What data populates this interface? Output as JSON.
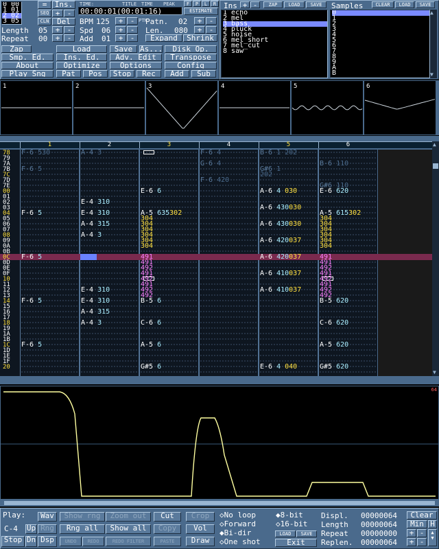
{
  "song_positions": [
    {
      "pos": "0",
      "pat": "00"
    },
    {
      "pos": "1",
      "pat": "01"
    },
    {
      "pos": "2",
      "pat": "02"
    },
    {
      "pos": "3",
      "pat": "05"
    }
  ],
  "top_left": {
    "eq": "=",
    "ins_btn": "Ins.",
    "seq": "SEQ",
    "cln": "CLN",
    "del": "Del",
    "length_label": "Length",
    "length_val": "05",
    "repeat_label": "Repeat",
    "repeat_val": "00",
    "plus": "+",
    "minus": "-"
  },
  "time": {
    "time_label": "TIME:",
    "time_value": "00:00:01(00:01:16)",
    "title_tab": "TITLE",
    "time_tab": "TIME",
    "peak_tab": "PEAK",
    "estimate": "ESTIMATE"
  },
  "tempo": {
    "bpm_label": "BPM",
    "bpm_val": "125",
    "spd_label": "Spd",
    "spd_val": "06",
    "add_label": "Add",
    "add_val": "01",
    "pattern_label": "Patn.",
    "pattern_val": "02",
    "len_label": "Len.",
    "len_val": "080",
    "expand": "Expand",
    "shrink": "Shrink",
    "ptn_tab": "PTN"
  },
  "instruments": {
    "label": "Ins",
    "zap": "ZAP",
    "load": "LOAD",
    "save": "SAVE",
    "items": [
      {
        "num": "1",
        "name": "echo"
      },
      {
        "num": "2",
        "name": "mel"
      },
      {
        "num": "3",
        "name": "bass"
      },
      {
        "num": "4",
        "name": "pluck"
      },
      {
        "num": "5",
        "name": "noise"
      },
      {
        "num": "6",
        "name": "mel_short"
      },
      {
        "num": "7",
        "name": "mel_cut"
      },
      {
        "num": "8",
        "name": "saw"
      }
    ],
    "selected": 2
  },
  "samples": {
    "label": "Samples",
    "clear": "CLEAR",
    "load": "LOAD",
    "save": "SAVE",
    "items": [
      "0",
      "1",
      "2",
      "3",
      "4",
      "5",
      "6",
      "7",
      "8",
      "9",
      "A",
      "B"
    ],
    "selected": 0
  },
  "menu": [
    [
      "Zap",
      "Load",
      "Save",
      "As...",
      "Disk Op."
    ],
    [
      "Smp. Ed.",
      "Ins. Ed.",
      "Adv. Edit",
      "Transpose"
    ],
    [
      "About",
      "Optimize",
      "Options",
      "Config"
    ],
    [
      "Play Sng",
      "Pat",
      "Pos",
      "Stop",
      "Rec",
      "Add",
      "Sub"
    ]
  ],
  "scopes": [
    "1",
    "2",
    "3",
    "4",
    "5",
    "6"
  ],
  "channels": [
    "1",
    "2",
    "3",
    "4",
    "5",
    "6"
  ],
  "rows": [
    {
      "n": "78",
      "c": [
        "F-6 530",
        "A-4 3",
        "",
        "F-6 4",
        "B-6 1   202",
        ""
      ],
      "d": 1,
      "box": [
        0,
        0,
        1,
        0,
        0,
        0
      ]
    },
    {
      "n": "79",
      "c": [
        "",
        "",
        "",
        "",
        "",
        ""
      ],
      "d": 1
    },
    {
      "n": "7A",
      "c": [
        "",
        "",
        "",
        "G-6 4",
        "",
        "B-6 110"
      ],
      "d": 1
    },
    {
      "n": "7B",
      "c": [
        "F-6 5",
        "",
        "",
        "",
        "G#6 1",
        ""
      ],
      "d": 1
    },
    {
      "n": "7C",
      "c": [
        "",
        "",
        "",
        "",
        "        202",
        ""
      ],
      "d": 1
    },
    {
      "n": "7D",
      "c": [
        "",
        "",
        "",
        "F-6 420",
        "",
        ""
      ],
      "d": 1
    },
    {
      "n": "7E",
      "c": [
        "",
        "",
        "",
        "",
        "",
        "G#6 110"
      ],
      "d": 1
    },
    {
      "n": "00",
      "c": [
        "",
        "",
        "E-6 6",
        "",
        "A-6 4   030",
        "E-6 620"
      ]
    },
    {
      "n": "01",
      "c": [
        "",
        "",
        "",
        "",
        "",
        ""
      ]
    },
    {
      "n": "02",
      "c": [
        "",
        "E-4 310",
        "",
        "",
        "",
        ""
      ]
    },
    {
      "n": "03",
      "c": [
        "",
        "",
        "",
        "",
        "A-6 430030",
        ""
      ]
    },
    {
      "n": "04",
      "c": [
        "F-6 5",
        "E-4 310",
        "A-5 635302",
        "",
        "",
        "A-5 615302"
      ]
    },
    {
      "n": "05",
      "c": [
        "",
        "",
        "       304",
        "",
        "",
        "       304"
      ]
    },
    {
      "n": "06",
      "c": [
        "",
        "A-4 315",
        "       304",
        "",
        "A-6 430030",
        "       304"
      ]
    },
    {
      "n": "07",
      "c": [
        "",
        "",
        "       304",
        "",
        "",
        "       304"
      ]
    },
    {
      "n": "08",
      "c": [
        "",
        "A-4 3",
        "       304",
        "",
        "",
        "       304"
      ]
    },
    {
      "n": "09",
      "c": [
        "",
        "",
        "       304",
        "",
        "A-6 420037",
        "       304"
      ]
    },
    {
      "n": "0A",
      "c": [
        "",
        "",
        "       304",
        "",
        "",
        "       304"
      ]
    },
    {
      "n": "0B",
      "c": [
        "",
        "",
        "",
        "",
        "",
        ""
      ]
    },
    {
      "n": "0C",
      "c": [
        "F-6 5",
        "",
        "       491",
        "",
        "A-6 420037",
        "       491"
      ],
      "sel": 1
    },
    {
      "n": "0D",
      "c": [
        "",
        "",
        "       491",
        "",
        "",
        "       491"
      ]
    },
    {
      "n": "0E",
      "c": [
        "",
        "",
        "       492",
        "",
        "",
        "       492"
      ]
    },
    {
      "n": "0F",
      "c": [
        "",
        "",
        "       491",
        "",
        "A-6 410037",
        "       491"
      ]
    },
    {
      "n": "10",
      "c": [
        "",
        "",
        "       492",
        "",
        "",
        "       492"
      ],
      "box": [
        0,
        0,
        1,
        0,
        0,
        1
      ]
    },
    {
      "n": "11",
      "c": [
        "",
        "",
        "       491",
        "",
        "",
        "       491"
      ]
    },
    {
      "n": "12",
      "c": [
        "",
        "E-4 310",
        "       492",
        "",
        "A-6 410037",
        "       492"
      ]
    },
    {
      "n": "13",
      "c": [
        "",
        "",
        "       492",
        "",
        "",
        "       492"
      ]
    },
    {
      "n": "14",
      "c": [
        "F-6 5",
        "E-4 310",
        "B-5 6",
        "",
        "",
        "B-5 620"
      ]
    },
    {
      "n": "15",
      "c": [
        "",
        "",
        "",
        "",
        "",
        ""
      ]
    },
    {
      "n": "16",
      "c": [
        "",
        "A-4 315",
        "",
        "",
        "",
        ""
      ]
    },
    {
      "n": "17",
      "c": [
        "",
        "",
        "",
        "",
        "",
        ""
      ]
    },
    {
      "n": "18",
      "c": [
        "",
        "A-4 3",
        "C-6 6",
        "",
        "",
        "C-6 620"
      ]
    },
    {
      "n": "19",
      "c": [
        "",
        "",
        "",
        "",
        "",
        ""
      ]
    },
    {
      "n": "1A",
      "c": [
        "",
        "",
        "",
        "",
        "",
        ""
      ]
    },
    {
      "n": "1B",
      "c": [
        "",
        "",
        "",
        "",
        "",
        ""
      ]
    },
    {
      "n": "1C",
      "c": [
        "F-6 5",
        "",
        "A-5 6",
        "",
        "",
        "A-5 620"
      ]
    },
    {
      "n": "1D",
      "c": [
        "",
        "",
        "",
        "",
        "",
        ""
      ]
    },
    {
      "n": "1E",
      "c": [
        "",
        "",
        "",
        "",
        "",
        ""
      ]
    },
    {
      "n": "1F",
      "c": [
        "",
        "",
        "",
        "",
        "",
        ""
      ]
    },
    {
      "n": "20",
      "c": [
        "",
        "",
        "G#5 6",
        "",
        "E-6 4   040",
        "G#5 620"
      ]
    }
  ],
  "sample_editor": {
    "readout": "64"
  },
  "bottom": {
    "play_label": "Play:",
    "note": "C-4",
    "wav": "Wav",
    "up": "Up",
    "rng": "Rng",
    "stop": "Stop",
    "dn": "Dn",
    "dsp": "Dsp",
    "show_rng": "Show rng",
    "zoom_out": "Zoom out",
    "rng_all": "Rng all",
    "show_all": "Show all",
    "undo": "UNDO",
    "redo": "REDO",
    "redo_filter": "REDO FILTER",
    "paste": "PASTE",
    "cut": "Cut",
    "crop": "Crop",
    "copy": "Copy",
    "vol": "Vol",
    "draw": "Draw",
    "no_loop": "No loop",
    "forward": "Forward",
    "bidir": "Bi-dir",
    "one_shot": "One shot",
    "bit8": "8-bit",
    "bit16": "16-bit",
    "load": "LOAD",
    "save": "SAVE",
    "exit": "Exit",
    "displ_label": "Displ.",
    "displ_val": "00000064",
    "length_label": "Length",
    "length_val": "00000064",
    "repeat_label": "Repeat",
    "repeat_val": "00000000",
    "replen_label": "Replen.",
    "replen_val": "00000064",
    "clear": "Clear",
    "min": "Min",
    "h": "H",
    "plus": "+",
    "minus": "-"
  }
}
